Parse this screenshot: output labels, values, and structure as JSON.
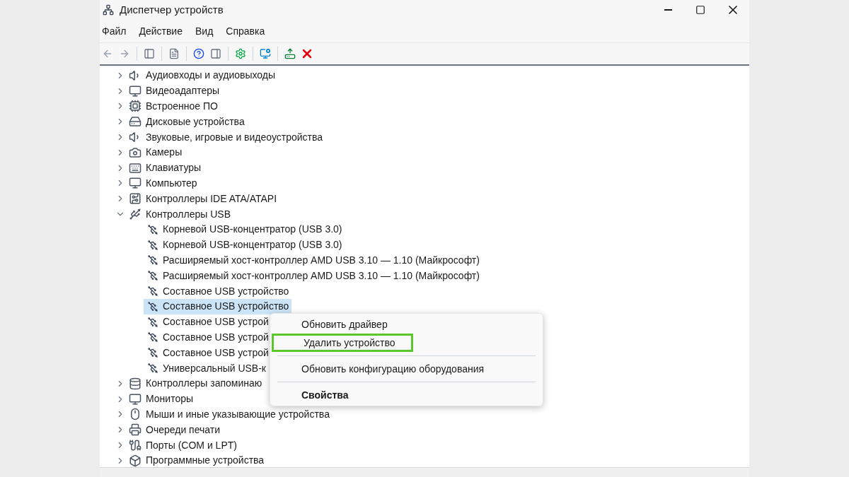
{
  "window": {
    "title": "Диспетчер устройств"
  },
  "menu": [
    "Файл",
    "Действие",
    "Вид",
    "Справка"
  ],
  "tree": [
    {
      "label": "Аудиовходы и аудиовыходы",
      "kind": "audio",
      "expanded": false
    },
    {
      "label": "Видеоадаптеры",
      "kind": "display",
      "expanded": false
    },
    {
      "label": "Встроенное ПО",
      "kind": "chip",
      "expanded": false
    },
    {
      "label": "Дисковые устройства",
      "kind": "disk",
      "expanded": false
    },
    {
      "label": "Звуковые, игровые и видеоустройства",
      "kind": "audio",
      "expanded": false
    },
    {
      "label": "Камеры",
      "kind": "camera",
      "expanded": false
    },
    {
      "label": "Клавиатуры",
      "kind": "keyboard",
      "expanded": false
    },
    {
      "label": "Компьютер",
      "kind": "computer",
      "expanded": false
    },
    {
      "label": "Контроллеры IDE ATA/ATAPI",
      "kind": "board",
      "expanded": false
    },
    {
      "label": "Контроллеры USB",
      "kind": "usb",
      "expanded": true,
      "children": [
        {
          "label": "Корневой USB-концентратор (USB 3.0)",
          "selected": false
        },
        {
          "label": "Корневой USB-концентратор (USB 3.0)",
          "selected": false
        },
        {
          "label": "Расширяемый хост-контроллер AMD USB 3.10 — 1.10 (Майкрософт)",
          "selected": false
        },
        {
          "label": "Расширяемый хост-контроллер AMD USB 3.10 — 1.10 (Майкрософт)",
          "selected": false
        },
        {
          "label": "Составное USB устройство",
          "selected": false
        },
        {
          "label": "Составное USB устройство",
          "selected": true
        },
        {
          "label": "Составное USB устрой",
          "selected": false
        },
        {
          "label": "Составное USB устрой",
          "selected": false
        },
        {
          "label": "Составное USB устрой",
          "selected": false
        },
        {
          "label": "Универсальный USB-к",
          "selected": false
        }
      ]
    },
    {
      "label": "Контроллеры запоминаю",
      "kind": "storage",
      "expanded": false
    },
    {
      "label": "Мониторы",
      "kind": "computer",
      "expanded": false
    },
    {
      "label": "Мыши и иные указывающие устройства",
      "kind": "mouse",
      "expanded": false
    },
    {
      "label": "Очереди печати",
      "kind": "printer",
      "expanded": false
    },
    {
      "label": "Порты (COM и LPT)",
      "kind": "port",
      "expanded": false
    },
    {
      "label": "Программные устройства",
      "kind": "software",
      "expanded": false
    }
  ],
  "context_menu": [
    {
      "label": "Обновить драйвер",
      "highlighted": false,
      "bold": false
    },
    {
      "label": "Удалить устройство",
      "highlighted": true,
      "bold": false
    },
    {
      "kind": "separator"
    },
    {
      "label": "Обновить конфигурацию оборудования",
      "highlighted": false,
      "bold": false
    },
    {
      "kind": "separator"
    },
    {
      "label": "Свойства",
      "highlighted": false,
      "bold": true
    }
  ]
}
